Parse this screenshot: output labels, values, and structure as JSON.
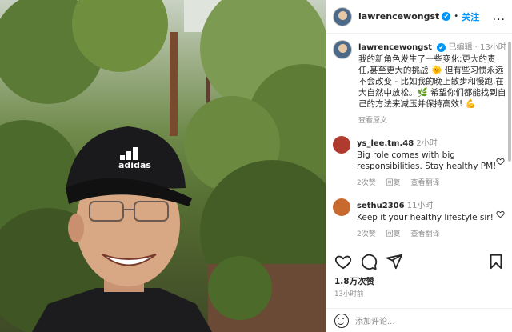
{
  "header": {
    "username": "lawrencewongst",
    "verified_icon": "✔",
    "separator": "•",
    "follow_label": "关注",
    "more_label": "..."
  },
  "post": {
    "username": "lawrencewongst",
    "edited": "已编辑",
    "time": "13小时",
    "caption": "我的新角色发生了一些变化:更大的责任,甚至更大的挑战!🌞 但有些习惯永远不会改变 - 比如我的晚上散步和慢跑,在大自然中放松。🌿 希望你们都能找到自己的方法来减压并保持高效! 💪",
    "translate_label": "查看原文"
  },
  "comments": [
    {
      "username": "ys_lee.tm.48",
      "time": "2小时",
      "text": "Big role comes with big responsibilities. Stay healthy PM!",
      "likes": "2次赞",
      "reply": "回复",
      "translate": "查看翻译",
      "avatar_color": "#b03a2e"
    },
    {
      "username": "sethu2306",
      "time": "11小时",
      "text": "Keep it your healthy lifestyle sir!",
      "likes": "2次赞",
      "reply": "回复",
      "translate": "查看翻译",
      "avatar_color": "#c8692e"
    }
  ],
  "actions": {
    "likes": "1.8万次赞",
    "time": "13小时前"
  },
  "add_comment": {
    "placeholder": "添加评论..."
  },
  "photo": {
    "cap_logo": "adidas"
  }
}
